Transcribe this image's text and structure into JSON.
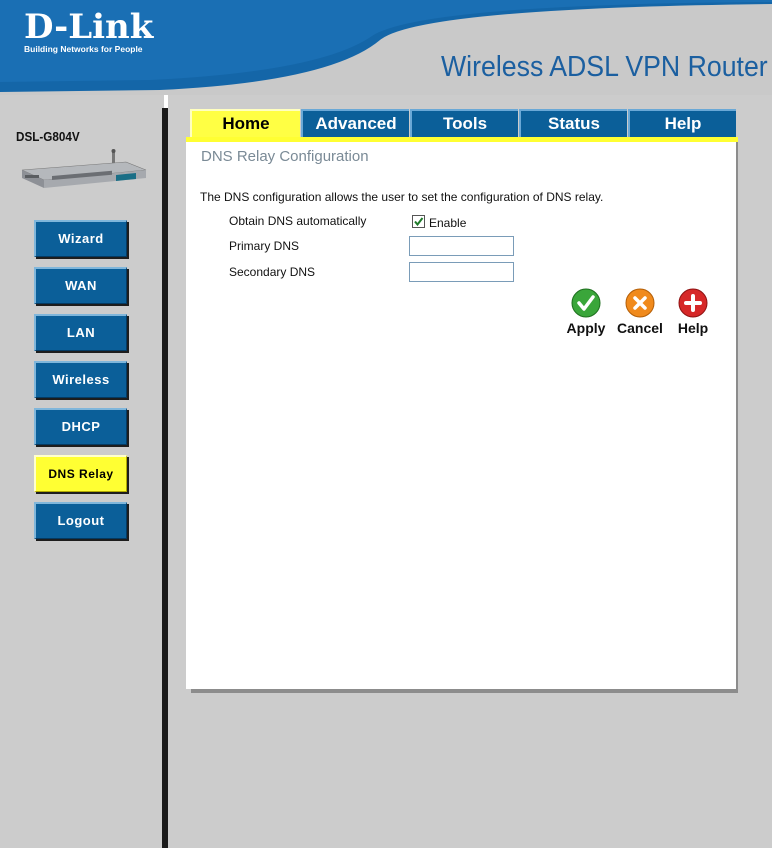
{
  "header": {
    "logo_text": "D-Link",
    "logo_tagline": "Building Networks for People",
    "product_title": "Wireless ADSL VPN Router"
  },
  "sidebar": {
    "model": "DSL-G804V",
    "items": [
      {
        "label": "Wizard"
      },
      {
        "label": "WAN"
      },
      {
        "label": "LAN"
      },
      {
        "label": "Wireless"
      },
      {
        "label": "DHCP"
      },
      {
        "label": "DNS Relay",
        "active": true
      },
      {
        "label": "Logout"
      }
    ]
  },
  "tabs": [
    {
      "label": "Home",
      "active": true
    },
    {
      "label": "Advanced"
    },
    {
      "label": "Tools"
    },
    {
      "label": "Status"
    },
    {
      "label": "Help"
    }
  ],
  "content": {
    "title": "DNS Relay Configuration",
    "description": "The DNS configuration allows the user to set the configuration of DNS relay.",
    "obtain_label": "Obtain DNS automatically",
    "enable_label": "Enable",
    "enable_checked": true,
    "primary_label": "Primary DNS",
    "primary_value": "",
    "secondary_label": "Secondary DNS",
    "secondary_value": ""
  },
  "actions": {
    "apply_label": "Apply",
    "cancel_label": "Cancel",
    "help_label": "Help"
  },
  "colors": {
    "brand_blue": "#0b5f99",
    "active_yellow": "#ffff33",
    "header_blue": "#1b5fa0"
  }
}
